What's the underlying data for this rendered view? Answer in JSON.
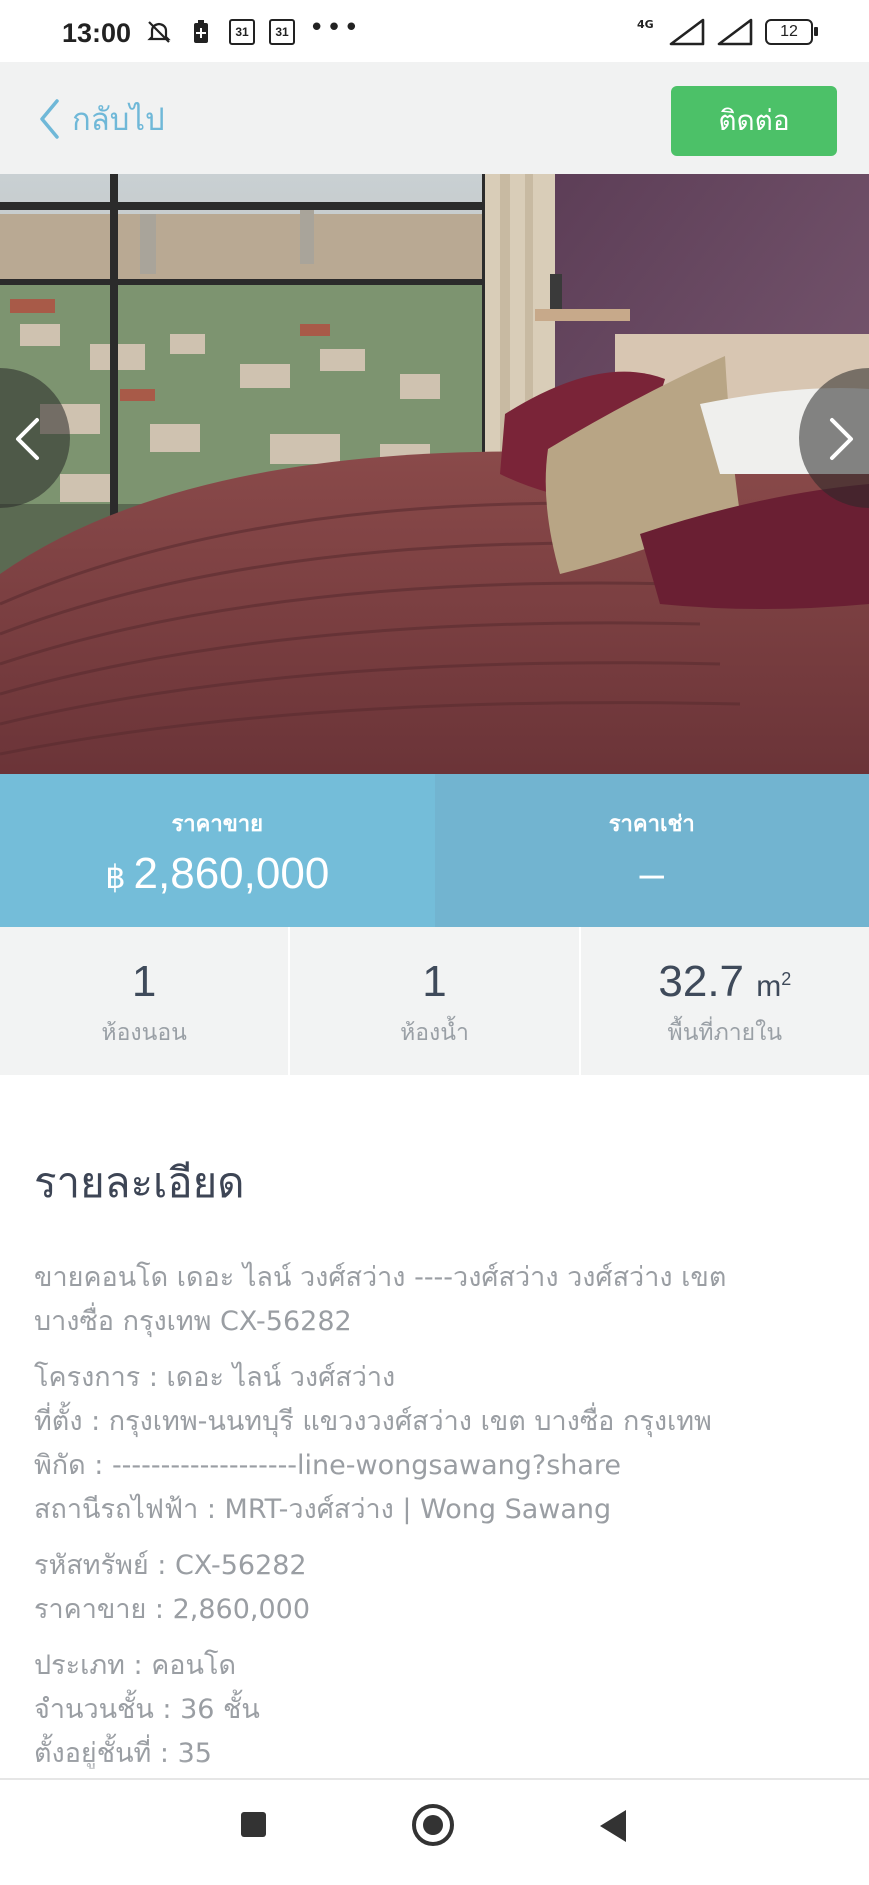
{
  "status_bar": {
    "time": "13:00",
    "calendar_day_1": "31",
    "calendar_day_2": "31",
    "network": "4G",
    "battery": "12"
  },
  "header": {
    "back_label": "กลับไป",
    "contact_label": "ติดต่อ"
  },
  "price": {
    "sale_label": "ราคาขาย",
    "sale_currency": "฿",
    "sale_value": "2,860,000",
    "rent_label": "ราคาเช่า",
    "rent_value": "–"
  },
  "specs": [
    {
      "value": "1",
      "label": "ห้องนอน"
    },
    {
      "value": "1",
      "label": "ห้องน้ำ"
    },
    {
      "value": "32.7",
      "unit": "m",
      "unit_sup": "2",
      "label": "พื้นที่ภายใน"
    }
  ],
  "details": {
    "title": "รายละเอียด",
    "paragraphs": [
      [
        "ขายคอนโด เดอะ ไลน์ วงศ์สว่าง ----วงศ์สว่าง วงศ์สว่าง เขต",
        "บางซื่อ กรุงเทพ CX-56282"
      ],
      [
        "โครงการ : เดอะ ไลน์ วงศ์สว่าง",
        "ที่ตั้ง : กรุงเทพ-นนทบุรี แขวงวงศ์สว่าง เขต บางซื่อ กรุงเทพ",
        "พิกัด : -------------------line-wongsawang?share",
        "สถานีรถไฟฟ้า : MRT-วงศ์สว่าง | Wong Sawang"
      ],
      [
        "รหัสทรัพย์ : CX-56282",
        "ราคาขาย : 2,860,000"
      ],
      [
        "ประเภท : คอนโด",
        "จำนวนชั้น : 36 ชั้น",
        "ตั้งอยู่ชั้นที่ : 35"
      ]
    ]
  }
}
